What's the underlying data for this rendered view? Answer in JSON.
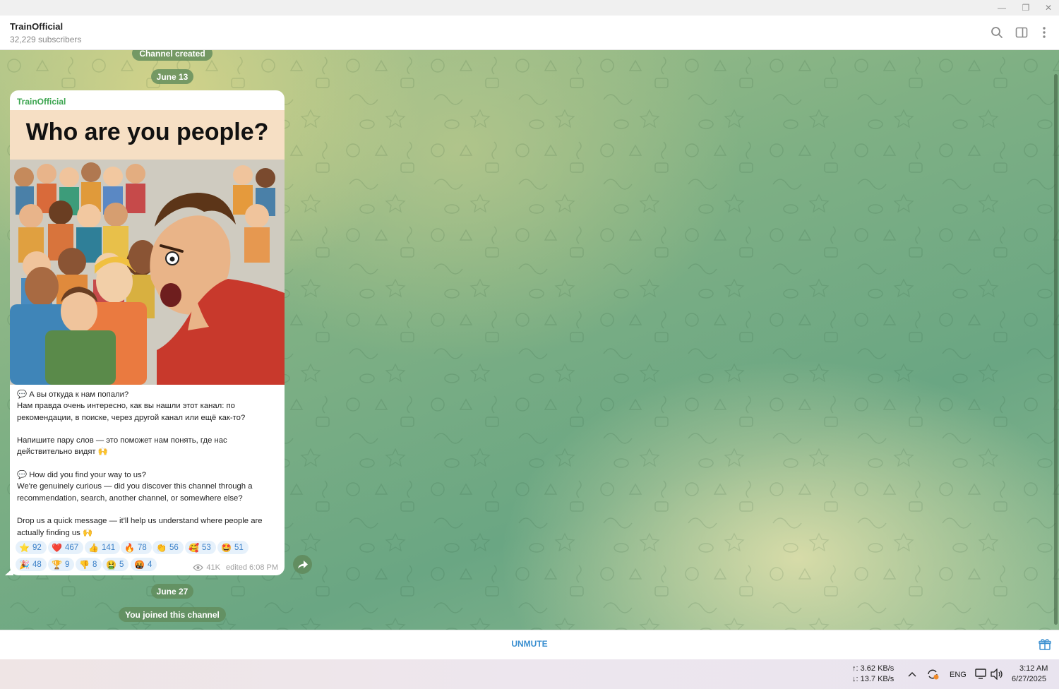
{
  "header": {
    "title": "TrainOfficial",
    "subtitle": "32,229 subscribers"
  },
  "service": {
    "channel_created": "Channel created",
    "date1": "June 13",
    "date2": "June 27",
    "joined": "You joined this channel"
  },
  "post": {
    "author": "TrainOfficial",
    "image_headline": "Who are you people?",
    "lines": [
      "💬 А вы откуда к нам попали?",
      "Нам правда очень интересно, как вы нашли этот канал: по",
      "рекомендации, в поиске, через другой канал или ещё как-то?",
      "",
      "Напишите пару слов — это поможет нам понять, где нас",
      "действительно видят 🙌",
      "",
      "💬 How did you find your way to us?",
      "We're genuinely curious — did you discover this channel through a",
      "recommendation, search, another channel, or somewhere else?",
      "",
      "Drop us a quick message — it'll help us understand where people are",
      "actually finding us 🙌"
    ],
    "reactions_row1": [
      {
        "emoji": "⭐",
        "count": "92"
      },
      {
        "emoji": "❤️",
        "count": "467"
      },
      {
        "emoji": "👍",
        "count": "141"
      },
      {
        "emoji": "🔥",
        "count": "78"
      },
      {
        "emoji": "👏",
        "count": "56"
      },
      {
        "emoji": "🥰",
        "count": "53"
      },
      {
        "emoji": "🤩",
        "count": "51"
      }
    ],
    "reactions_row2": [
      {
        "emoji": "🎉",
        "count": "48"
      },
      {
        "emoji": "🏆",
        "count": "9"
      },
      {
        "emoji": "👎",
        "count": "8"
      },
      {
        "emoji": "🤮",
        "count": "5"
      },
      {
        "emoji": "🤬",
        "count": "4"
      }
    ],
    "views": "41K",
    "edited": "edited 6:08 PM"
  },
  "bottom": {
    "unmute": "UNMUTE"
  },
  "taskbar": {
    "upload": "↑: 3.62 KB/s",
    "download": "↓: 13.7 KB/s",
    "lang": "ENG",
    "time": "3:12 AM",
    "date": "6/27/2025"
  }
}
